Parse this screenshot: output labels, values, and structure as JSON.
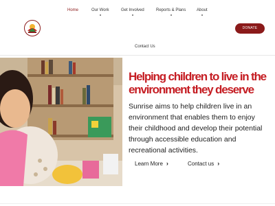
{
  "nav": {
    "items": [
      {
        "label": "Home"
      },
      {
        "label": "Our Work"
      },
      {
        "label": "Get Involved"
      },
      {
        "label": "Reports & Plans"
      },
      {
        "label": "About"
      }
    ],
    "contact_label": "Contact Us"
  },
  "header": {
    "donate_label": "DONATE"
  },
  "hero": {
    "headline": "Helping children to live in the environment they deserve",
    "description": "Sunrise aims to help children live in an environment that enables them to enjoy their childhood and develop their potential through accessible education and recreational activities.",
    "learn_more_label": "Learn More",
    "contact_label": "Contact us",
    "chevron": "›"
  },
  "colors": {
    "brand": "#8b1a1a",
    "headline": "#c51d23"
  },
  "icons": {
    "logo": "organization-logo-icon",
    "cta_arrow": "chevron-right-icon"
  }
}
